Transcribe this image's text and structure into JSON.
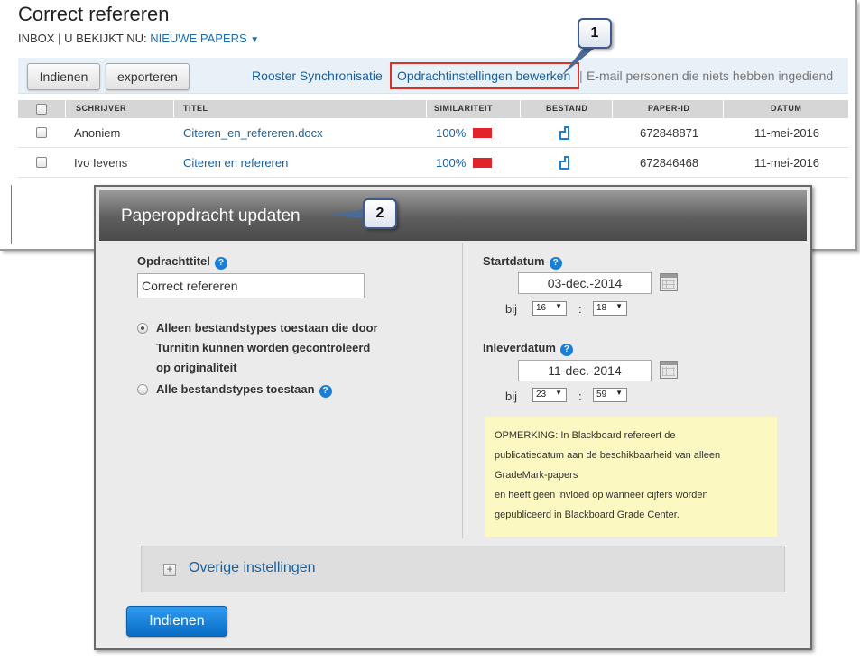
{
  "inbox": {
    "title": "Correct refereren",
    "nav": {
      "inbox": "INBOX",
      "sep": "|",
      "viewing_prefix": "U BEKIJKT NU:",
      "viewing_value": "NIEUWE PAPERS",
      "caret": "▼"
    },
    "buttons": {
      "submit": "Indienen",
      "export": "exporteren"
    },
    "links": {
      "sync": "Rooster Synchronisatie",
      "edit_settings": "Opdrachtinstellingen bewerken",
      "sep": "|",
      "email": "E-mail personen die niets hebben ingediend"
    },
    "table": {
      "headers": {
        "author": "SCHRIJVER",
        "title": "TITEL",
        "similarity": "SIMILARITEIT",
        "file": "BESTAND",
        "paper_id": "PAPER-ID",
        "date": "DATUM"
      },
      "rows": [
        {
          "author": "Anoniem",
          "title": "Citeren_en_refereren.docx",
          "similarity": "100%",
          "paper_id": "672848871",
          "date": "11-mei-2016"
        },
        {
          "author": "Ivo Ievens",
          "title": "Citeren en refereren",
          "similarity": "100%",
          "paper_id": "672846468",
          "date": "11-mei-2016"
        }
      ]
    }
  },
  "callouts": {
    "one": "1",
    "two": "2"
  },
  "modal": {
    "title": "Paperopdracht updaten",
    "assignment_title_label": "Opdrachttitel",
    "assignment_title_value": "Correct refereren",
    "help": "?",
    "radio_turnitin": [
      "Alleen bestandstypes toestaan die door",
      "Turnitin kunnen worden gecontroleerd",
      "op originaliteit"
    ],
    "radio_all": "Alle bestandstypes toestaan",
    "start_label": "Startdatum",
    "start_date": "03-dec.-2014",
    "start_hour": "16",
    "start_minute": "18",
    "due_label": "Inleverdatum",
    "due_date": "11-dec.-2014",
    "due_hour": "23",
    "due_minute": "59",
    "at_label": "bij",
    "colon": ":",
    "note_lines": [
      "OPMERKING: In Blackboard refereert de",
      "publicatiedatum aan de beschikbaarheid van alleen",
      "GradeMark-papers",
      "en heeft geen invloed op wanneer cijfers worden",
      "gepubliceerd in Blackboard Grade Center."
    ],
    "more_settings": "Overige instellingen",
    "plus": "+",
    "submit": "Indienen"
  },
  "colors": {
    "link": "#1b5f9a",
    "highlight": "#d9322b",
    "similarity_bar": "#e3232a",
    "primary_button": "#0a6cc4",
    "note_bg": "#fbf8c2"
  }
}
